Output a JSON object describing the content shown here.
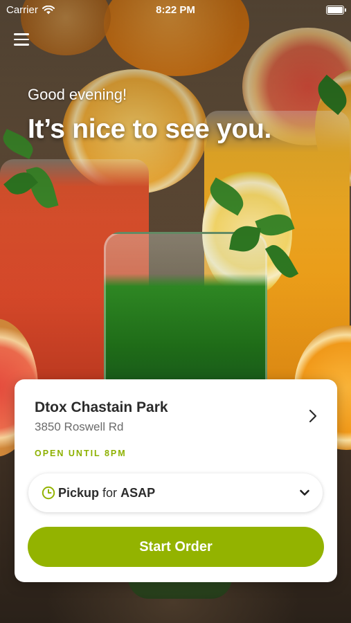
{
  "status_bar": {
    "carrier": "Carrier",
    "time": "8:22 PM"
  },
  "header": {
    "greeting": "Good evening!",
    "headline": "It’s nice to see you."
  },
  "location_card": {
    "store_name": "Dtox Chastain Park",
    "address": "3850 Roswell Rd",
    "open_status": "OPEN UNTIL 8PM",
    "pickup": {
      "method": "Pickup",
      "connector": "for",
      "time": "ASAP"
    },
    "start_order_label": "Start Order"
  },
  "colors": {
    "accent": "#93b300",
    "open_status": "#8db100",
    "card_bg": "#ffffff",
    "text_dark": "#2b2b2b"
  },
  "icons": {
    "menu": "hamburger-menu-icon",
    "chevron_right": "chevron-right-icon",
    "clock": "clock-icon",
    "chevron_down": "chevron-down-icon",
    "wifi": "wifi-icon",
    "battery": "battery-icon"
  }
}
